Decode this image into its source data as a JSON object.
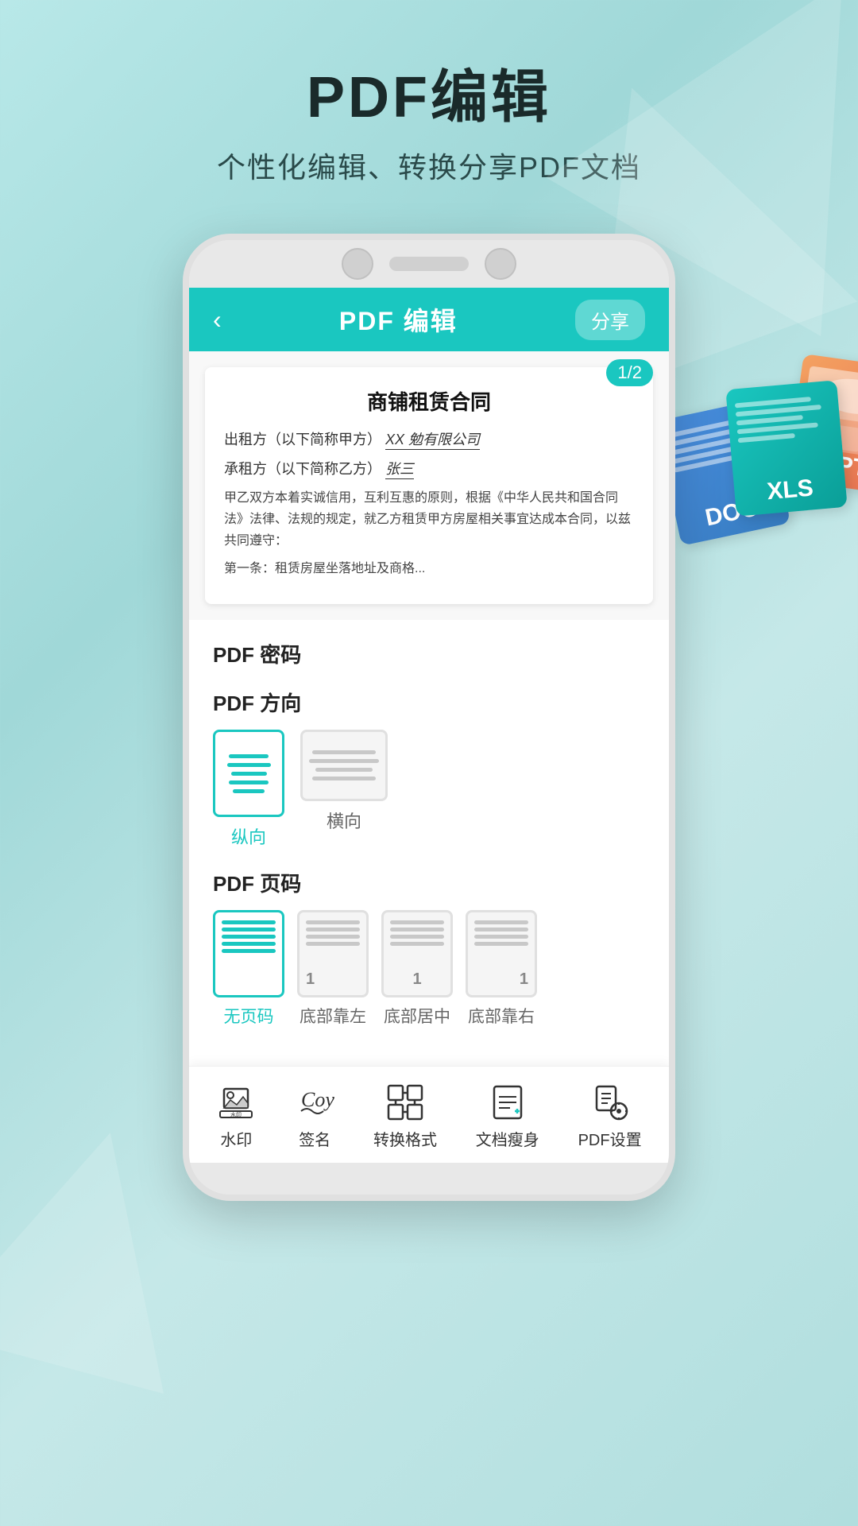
{
  "header": {
    "main_title": "PDF编辑",
    "sub_title": "个性化编辑、转换分享PDF文档"
  },
  "app": {
    "toolbar": {
      "back_label": "‹",
      "title": "PDF 编辑",
      "share_label": "分享"
    },
    "document": {
      "page_badge": "1/2",
      "doc_title": "商铺租赁合同",
      "line1_prefix": "出租方（以下简称甲方）",
      "line1_value": "XX 勉有限公司",
      "line2_prefix": "承租方（以下简称乙方）",
      "line2_value": "张三",
      "body_text": "甲乙双方本着实诚信用，互利互惠的原则，根据《中华人民共和国合同法》法律、法规的规定，就乙方租赁甲方房屋相关事宜达成本合同，以兹共同遵守：",
      "body_text2": "第一条：租赁房屋坐落地址及商格..."
    },
    "pdf_password": {
      "section_title": "PDF 密码"
    },
    "pdf_orientation": {
      "section_title": "PDF 方向",
      "options": [
        {
          "label": "纵向",
          "active": true
        },
        {
          "label": "横向",
          "active": false
        }
      ]
    },
    "pdf_pageno": {
      "section_title": "PDF 页码",
      "options": [
        {
          "label": "无页码",
          "active": true,
          "number": ""
        },
        {
          "label": "底部靠左",
          "active": false,
          "number": "1"
        },
        {
          "label": "底部居中",
          "active": false,
          "number": "1"
        },
        {
          "label": "底部靠右",
          "active": false,
          "number": "1"
        }
      ]
    },
    "bottom_toolbar": {
      "items": [
        {
          "label": "水印",
          "icon": "watermark"
        },
        {
          "label": "签名",
          "icon": "signature"
        },
        {
          "label": "转换格式",
          "icon": "convert"
        },
        {
          "label": "文档瘦身",
          "icon": "compress"
        },
        {
          "label": "PDF设置",
          "icon": "settings"
        }
      ]
    }
  },
  "floating_docs": [
    {
      "label": "DOC",
      "type": "doc"
    },
    {
      "label": "XLS",
      "type": "xls"
    },
    {
      "label": "PPT",
      "type": "ppt"
    }
  ]
}
